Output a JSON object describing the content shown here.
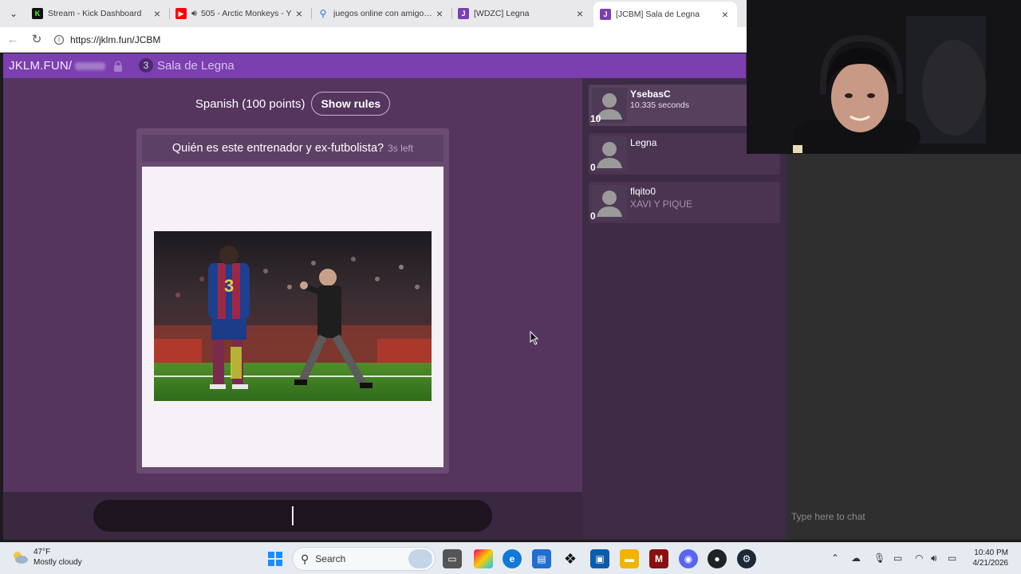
{
  "browser": {
    "tabs": [
      {
        "title": "Stream - Kick Dashboard",
        "icon": "kick-icon",
        "color": "#53fc18"
      },
      {
        "title": "505 - Arctic Monkeys - Y",
        "icon": "youtube-icon",
        "color": "#ff0000"
      },
      {
        "title": "juegos online con amigos - S",
        "icon": "search-icon",
        "color": "#1a73e8"
      },
      {
        "title": "[WDZC] Legna",
        "icon": "jklm-icon",
        "color": "#7b3fb0"
      },
      {
        "title": "[JCBM] Sala de Legna",
        "icon": "jklm-icon",
        "color": "#7b3fb0"
      }
    ],
    "url": "https://jklm.fun/JCBM"
  },
  "app": {
    "brand": "JKLM.FUN/",
    "room_number": "3",
    "room_name": "Sala de Legna",
    "rule_text": "Spanish (100 points)",
    "rules_button": "Show rules",
    "question": "Quién es este entrenador y ex-futbolista?",
    "time_left": "3s left",
    "answer_placeholder": "",
    "chat_placeholder": "Type here to chat"
  },
  "players": [
    {
      "name": "YsebasC",
      "score": "10",
      "detail": "10.335 seconds"
    },
    {
      "name": "Legna",
      "score": "0",
      "detail": ""
    },
    {
      "name": "flqito0",
      "score": "0",
      "detail": "XAVI Y PIQUE"
    }
  ],
  "taskbar": {
    "weather_temp": "47°F",
    "weather_desc": "Mostly cloudy",
    "search_label": "Search",
    "time": "10:40 PM",
    "date": "4/21/2026"
  },
  "colors": {
    "accent": "#7b3fb0",
    "page_bg": "#3f2a45",
    "game_bg": "#55355d"
  }
}
